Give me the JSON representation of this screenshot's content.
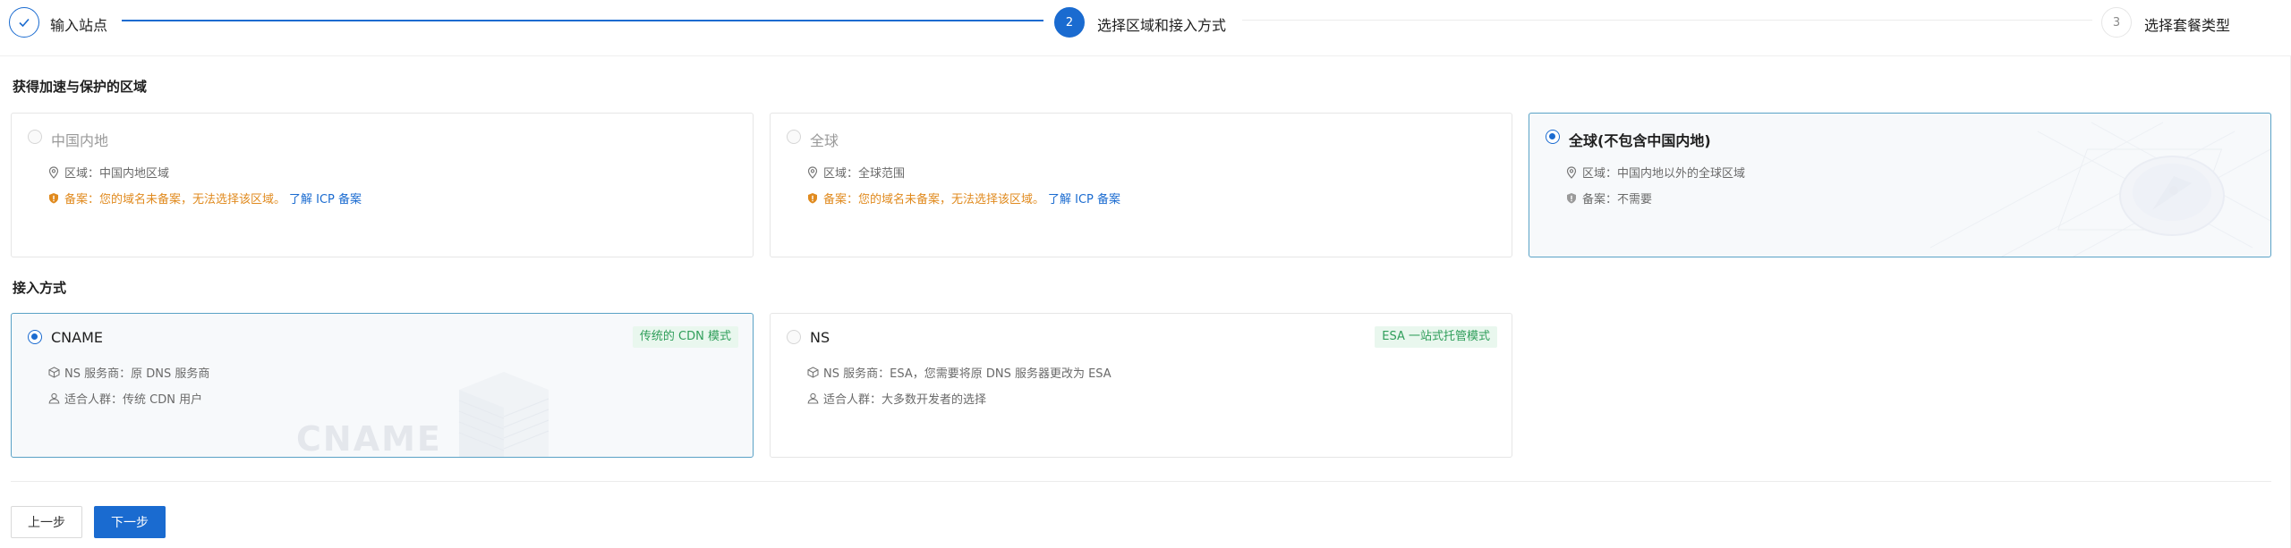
{
  "steps": [
    {
      "num": "1",
      "label": "输入站点",
      "state": "done"
    },
    {
      "num": "2",
      "label": "选择区域和接入方式",
      "state": "active"
    },
    {
      "num": "3",
      "label": "选择套餐类型",
      "state": "todo"
    }
  ],
  "region_section": {
    "title": "获得加速与保护的区域",
    "cards": [
      {
        "title": "中国内地",
        "region_text": "区域：中国内地区域",
        "icp_text": "备案：您的域名未备案，无法选择该区域。",
        "icp_link": "了解 ICP 备案",
        "selected": false,
        "disabled": true
      },
      {
        "title": "全球",
        "region_text": "区域：全球范围",
        "icp_text": "备案：您的域名未备案，无法选择该区域。",
        "icp_link": "了解 ICP 备案",
        "selected": false,
        "disabled": true
      },
      {
        "title": "全球(不包含中国内地)",
        "region_text": "区域：中国内地以外的全球区域",
        "icp_text": "备案：不需要",
        "selected": true,
        "disabled": false
      }
    ]
  },
  "access_section": {
    "title": "接入方式",
    "cards": [
      {
        "title": "CNAME",
        "tag": "传统的 CDN 模式",
        "ns_text": "NS 服务商：原 DNS 服务商",
        "audience_text": "适合人群：传统 CDN 用户",
        "watermark": "CNAME",
        "selected": true
      },
      {
        "title": "NS",
        "tag": "ESA 一站式托管模式",
        "ns_text": "NS 服务商：ESA，您需要将原 DNS 服务器更改为 ESA",
        "audience_text": "适合人群：大多数开发者的选择",
        "selected": false
      }
    ]
  },
  "footer": {
    "prev_label": "上一步",
    "next_label": "下一步"
  },
  "colors": {
    "primary": "#1a6bd0",
    "warning": "#e08a1e",
    "tag_bg": "#e9f7ee",
    "tag_text": "#2f9e5a"
  }
}
